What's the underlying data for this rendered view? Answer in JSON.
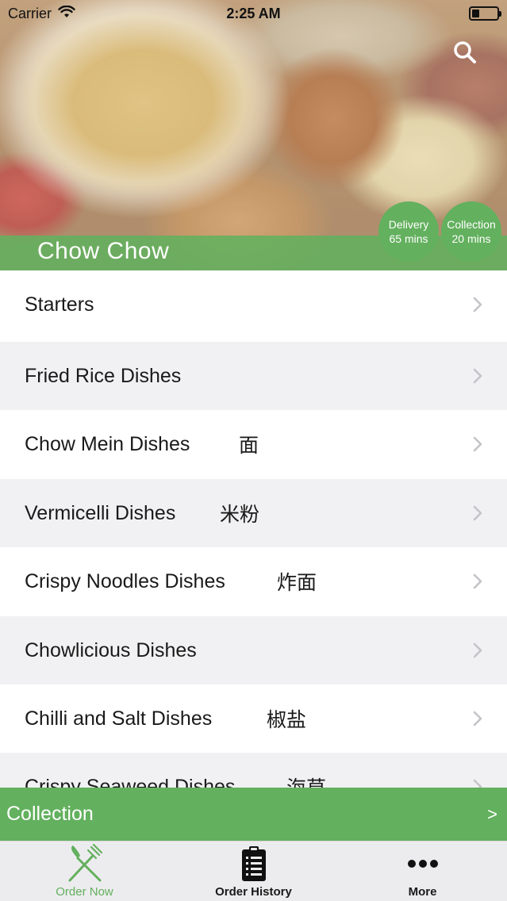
{
  "status_bar": {
    "carrier": "Carrier",
    "time": "2:25 AM"
  },
  "header": {
    "restaurant_name": "Chow Chow",
    "delivery": {
      "label": "Delivery",
      "time": "65 mins"
    },
    "collection": {
      "label": "Collection",
      "time": "20 mins"
    }
  },
  "categories": [
    {
      "label": "Starters",
      "chinese": ""
    },
    {
      "label": "Fried Rice Dishes",
      "chinese": ""
    },
    {
      "label": "Chow Mein Dishes",
      "chinese": "面"
    },
    {
      "label": "Vermicelli Dishes",
      "chinese": "米粉"
    },
    {
      "label": "Crispy Noodles Dishes",
      "chinese": "炸面"
    },
    {
      "label": "Chowlicious Dishes",
      "chinese": ""
    },
    {
      "label": "Chilli and Salt Dishes",
      "chinese": "椒盐"
    },
    {
      "label": "Crispy Seaweed Dishes",
      "chinese": "海草"
    }
  ],
  "order_mode_bar": {
    "label": "Collection",
    "arrow": ">"
  },
  "tabs": [
    {
      "label": "Order Now",
      "icon": "fork-knife-icon",
      "active": true
    },
    {
      "label": "Order History",
      "icon": "clipboard-list-icon",
      "active": false
    },
    {
      "label": "More",
      "icon": "more-dots-icon",
      "active": false
    }
  ],
  "colors": {
    "accent": "#63b05e",
    "row_alt": "#f1f1f3",
    "tab_bar": "#ececee"
  }
}
